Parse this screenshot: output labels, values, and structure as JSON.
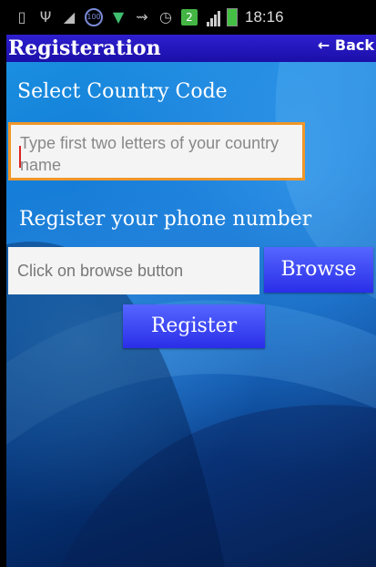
{
  "status_bar": {
    "time": "18:16",
    "icons": [
      "message-icon",
      "usb-icon",
      "notification-icon",
      "data-100-icon",
      "shield-icon",
      "missed-call-icon",
      "alarm-icon",
      "sim-icon",
      "signal-icon",
      "battery-charging-icon"
    ],
    "sim_badge": "2",
    "data_badge": "100"
  },
  "header": {
    "title": "Registeration",
    "back_label": "← Back"
  },
  "form": {
    "country_label": "Select Country Code",
    "country_placeholder": "Type  first two letters of your country name",
    "phone_label": "Register your phone number",
    "phone_placeholder": "Click on browse button",
    "browse_label": "Browse",
    "register_label": "Register"
  },
  "colors": {
    "title_bar": "#1f12bd",
    "button": "#3a3ef2",
    "input_focus_border": "#f0962a"
  }
}
